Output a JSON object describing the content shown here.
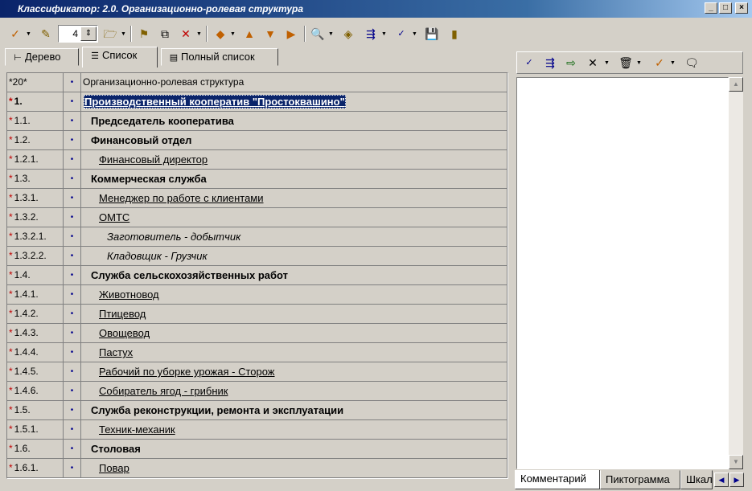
{
  "window": {
    "title": "Классификатор: 2.0. Организационно-ролевая структура",
    "controls": [
      "_",
      "□",
      "×"
    ]
  },
  "toolbar": {
    "spin_value": "4"
  },
  "tabs": [
    {
      "label": "Дерево",
      "icon": "tree-icon"
    },
    {
      "label": "Список",
      "icon": "list-icon",
      "active": true
    },
    {
      "label": "Полный список",
      "icon": "full-list-icon"
    }
  ],
  "table": {
    "header": {
      "code": "*20*",
      "bullet": "•",
      "name": "Организационно-ролевая структура"
    },
    "rows": [
      {
        "code": "1.",
        "name": "Производственный кооператив \"Простоквашино\"",
        "style": "selected",
        "level": 1
      },
      {
        "code": "1.1.",
        "name": "Председатель кооператива",
        "style": "bold",
        "level": 2
      },
      {
        "code": "1.2.",
        "name": "Финансовый отдел",
        "style": "bold",
        "level": 2
      },
      {
        "code": "1.2.1.",
        "name": "Финансовый директор",
        "style": "link",
        "level": 3
      },
      {
        "code": "1.3.",
        "name": "Коммерческая служба",
        "style": "bold",
        "level": 2
      },
      {
        "code": "1.3.1.",
        "name": "Менеджер по работе с клиентами",
        "style": "link",
        "level": 3
      },
      {
        "code": "1.3.2.",
        "name": "ОМТС",
        "style": "link",
        "level": 3
      },
      {
        "code": "1.3.2.1.",
        "name": "Заготовитель - добытчик",
        "style": "italic",
        "level": 4
      },
      {
        "code": "1.3.2.2.",
        "name": "Кладовщик - Грузчик",
        "style": "italic",
        "level": 4
      },
      {
        "code": "1.4.",
        "name": "Служба сельскохозяйственных работ",
        "style": "bold",
        "level": 2
      },
      {
        "code": "1.4.1.",
        "name": "Животновод",
        "style": "link",
        "level": 3
      },
      {
        "code": "1.4.2.",
        "name": "Птицевод",
        "style": "link",
        "level": 3
      },
      {
        "code": "1.4.3.",
        "name": "Овощевод",
        "style": "link",
        "level": 3
      },
      {
        "code": "1.4.4.",
        "name": "Пастух",
        "style": "link",
        "level": 3
      },
      {
        "code": "1.4.5.",
        "name": "Рабочий по уборке урожая - Сторож",
        "style": "link",
        "level": 3
      },
      {
        "code": "1.4.6.",
        "name": "Собиратель ягод - грибник",
        "style": "link",
        "level": 3
      },
      {
        "code": "1.5.",
        "name": "Служба реконструкции, ремонта и эксплуатации",
        "style": "bold",
        "level": 2
      },
      {
        "code": "1.5.1.",
        "name": "Техник-механик",
        "style": "link",
        "level": 3
      },
      {
        "code": "1.6.",
        "name": "Столовая",
        "style": "bold",
        "level": 2
      },
      {
        "code": "1.6.1.",
        "name": "Повар",
        "style": "link",
        "level": 3
      }
    ],
    "star": "*",
    "bullet": "•"
  },
  "right_panel": {
    "tabs": [
      {
        "label": "Комментарий",
        "active": true
      },
      {
        "label": "Пиктограмма"
      },
      {
        "label": "Шкал"
      }
    ]
  },
  "colors": {
    "title_bar": "#0a246a",
    "selection": "#0a246a",
    "star": "#c00000",
    "face": "#d4d0c8"
  }
}
